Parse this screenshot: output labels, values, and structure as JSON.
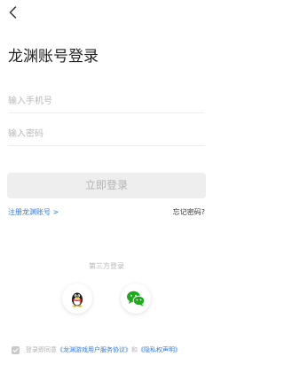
{
  "page": {
    "title": "龙渊账号登录"
  },
  "form": {
    "phone_placeholder": "输入手机号",
    "password_placeholder": "输入密码",
    "login_label": "立即登录"
  },
  "links": {
    "register": "注册龙渊账号 >",
    "forgot_password": "忘记密码?"
  },
  "third_party": {
    "label": "第三方登录",
    "providers": [
      "qq-icon",
      "wechat-icon"
    ]
  },
  "agreement": {
    "prefix": "登录即同意",
    "service_link": "《龙渊游戏用户服务协议》",
    "and": "和",
    "privacy_link": "《隐私权声明》"
  },
  "colors": {
    "link": "#2f7bdc",
    "button_disabled_bg": "#eeeeee",
    "button_disabled_text": "#b4b4b4",
    "wechat_green": "#1aad19"
  }
}
